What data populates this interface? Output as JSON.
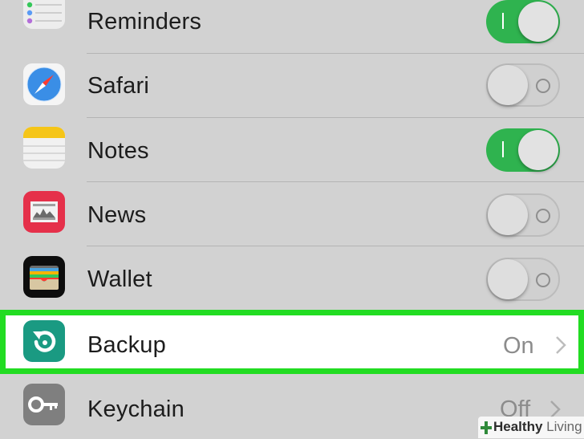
{
  "rows": [
    {
      "label": "Reminders",
      "icon": "reminders-icon",
      "control": "toggle",
      "toggle_on": true
    },
    {
      "label": "Safari",
      "icon": "safari-icon",
      "control": "toggle",
      "toggle_on": false
    },
    {
      "label": "Notes",
      "icon": "notes-icon",
      "control": "toggle",
      "toggle_on": true
    },
    {
      "label": "News",
      "icon": "news-icon",
      "control": "toggle",
      "toggle_on": false
    },
    {
      "label": "Wallet",
      "icon": "wallet-icon",
      "control": "toggle",
      "toggle_on": false
    },
    {
      "label": "Backup",
      "icon": "backup-icon",
      "control": "disclosure",
      "value": "On",
      "highlighted": true
    },
    {
      "label": "Keychain",
      "icon": "keychain-icon",
      "control": "disclosure",
      "value": "Off"
    }
  ],
  "colors": {
    "toggle_on": "#2fb34f",
    "highlight_border": "#22dc22",
    "background": "#d2d2d2",
    "backup_icon": "#1a9a82"
  },
  "watermark": {
    "brand": "Healthy",
    "suffix": "Living"
  }
}
